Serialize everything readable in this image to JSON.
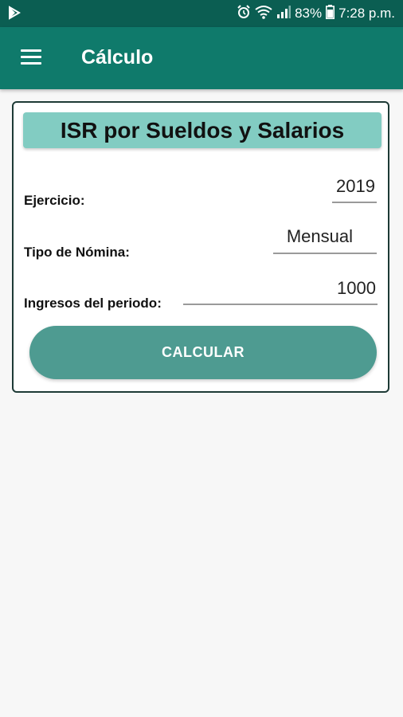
{
  "status_bar": {
    "battery": "83%",
    "time": "7:28 p.m."
  },
  "app_bar": {
    "title": "Cálculo"
  },
  "card": {
    "title": "ISR por Sueldos y Salarios",
    "ejercicio_label": "Ejercicio:",
    "ejercicio_value": "2019",
    "tipo_label": "Tipo de Nómina:",
    "tipo_value": "Mensual",
    "ingresos_label": "Ingresos del periodo:",
    "ingresos_value": "1000",
    "button_label": "CALCULAR"
  },
  "colors": {
    "status_bar": "#0b5e52",
    "app_bar": "#0f7a6b",
    "header": "#82ccc2",
    "button": "#4e9b91"
  }
}
